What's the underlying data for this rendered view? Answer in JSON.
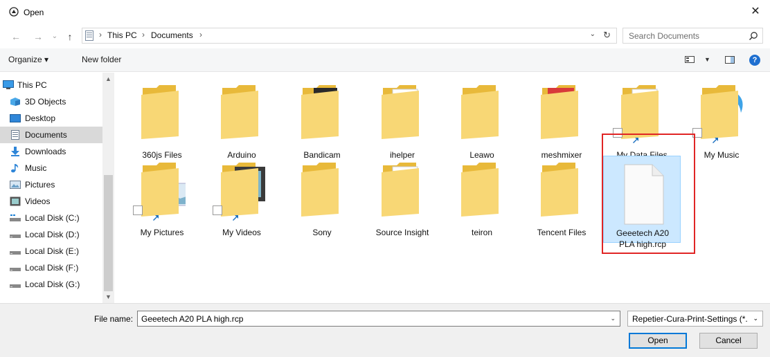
{
  "window": {
    "title": "Open",
    "close_label": "✕"
  },
  "nav": {
    "back": "←",
    "forward": "→",
    "recent": "⌄",
    "up": "↑",
    "breadcrumbs": [
      "This PC",
      "Documents"
    ],
    "separator": "›",
    "address_dropdown": "⌄",
    "refresh": "↻"
  },
  "search": {
    "placeholder": "Search Documents"
  },
  "toolbar": {
    "organize_label": "Organize ▾",
    "new_folder_label": "New folder",
    "help_label": "?"
  },
  "sidebar": {
    "items": [
      {
        "label": "This PC",
        "icon": "computer-icon"
      },
      {
        "label": "3D Objects",
        "icon": "cube-icon"
      },
      {
        "label": "Desktop",
        "icon": "desktop-icon"
      },
      {
        "label": "Documents",
        "icon": "documents-icon",
        "selected": true
      },
      {
        "label": "Downloads",
        "icon": "download-icon"
      },
      {
        "label": "Music",
        "icon": "music-icon"
      },
      {
        "label": "Pictures",
        "icon": "pictures-icon"
      },
      {
        "label": "Videos",
        "icon": "videos-icon"
      },
      {
        "label": "Local Disk (C:)",
        "icon": "drive-icon"
      },
      {
        "label": "Local Disk (D:)",
        "icon": "drive-icon"
      },
      {
        "label": "Local Disk (E:)",
        "icon": "drive-icon"
      },
      {
        "label": "Local Disk (F:)",
        "icon": "drive-icon"
      },
      {
        "label": "Local Disk (G:)",
        "icon": "drive-icon"
      }
    ]
  },
  "files": [
    {
      "label": "360js Files",
      "type": "folder"
    },
    {
      "label": "Arduino",
      "type": "folder-docs"
    },
    {
      "label": "Bandicam",
      "type": "folder-media"
    },
    {
      "label": "ihelper",
      "type": "folder-settings"
    },
    {
      "label": "Leawo",
      "type": "folder-docs"
    },
    {
      "label": "meshmixer",
      "type": "folder-app"
    },
    {
      "label": "My Data Files",
      "type": "folder-settings-shortcut"
    },
    {
      "label": "My Music",
      "type": "folder-music-shortcut"
    },
    {
      "label": "My Pictures",
      "type": "folder-pictures-shortcut"
    },
    {
      "label": "My Videos",
      "type": "folder-videos-shortcut"
    },
    {
      "label": "Sony",
      "type": "folder-docs"
    },
    {
      "label": "Source Insight",
      "type": "folder-settings"
    },
    {
      "label": "teiron",
      "type": "folder-docs"
    },
    {
      "label": "Tencent Files",
      "type": "folder-docs"
    },
    {
      "label": "Geeetech A20 PLA high.rcp",
      "type": "file",
      "selected": true
    }
  ],
  "bottom": {
    "filename_label": "File name:",
    "filename_value": "Geeetech A20 PLA high.rcp",
    "filter_value": "Repetier-Cura-Print-Settings (*.",
    "open_label": "Open",
    "cancel_label": "Cancel"
  },
  "colors": {
    "accent": "#0078d7",
    "highlight": "#e02424",
    "folder": "#f8d775",
    "selection": "#cce8ff"
  }
}
